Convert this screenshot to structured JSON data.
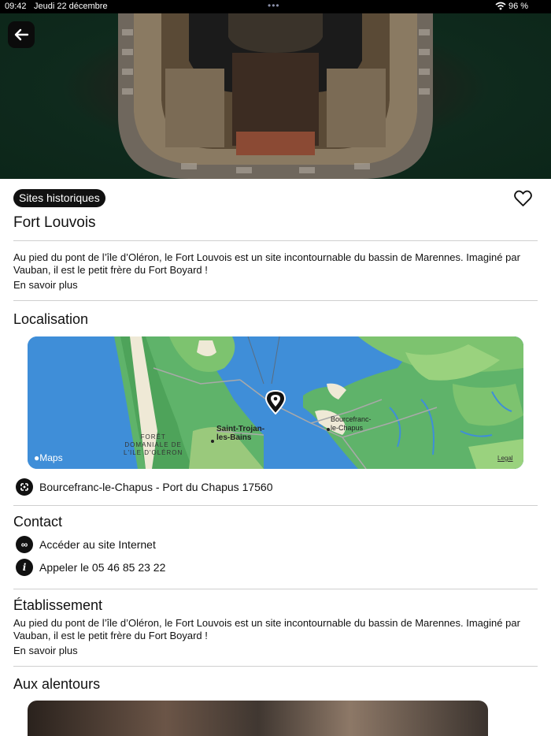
{
  "status_bar": {
    "time": "09:42",
    "date": "Jeudi 22 décembre",
    "battery": "96 %"
  },
  "place": {
    "category": "Sites historiques",
    "name": "Fort Louvois",
    "description": "Au pied du pont de l’île d’Oléron, le Fort Louvois est un site incontournable du bassin de Marennes. Imaginé par Vauban, il est le petit frère du Fort Boyard !",
    "more_label": "En savoir plus"
  },
  "location": {
    "heading": "Localisation",
    "address": "Bourcefranc-le-Chapus - Port du Chapus 17560",
    "map": {
      "label_saint_trojan": "Saint-Trojan-\nles-Bains",
      "label_bourcefranc": "Bourcefranc-\nle-Chapus",
      "label_foret": "FORÊT\nDOMANIALE DE\nL'ILE D'OLÉRON",
      "maps_logo": "Maps",
      "legal": "Legal"
    }
  },
  "contact": {
    "heading": "Contact",
    "website_label": "Accéder au site Internet",
    "phone_label": "Appeler le 05 46 85 23 22"
  },
  "establishment": {
    "heading": "Établissement",
    "description": "Au pied du pont de l’île d’Oléron, le Fort Louvois est un site incontournable du bassin de Marennes. Imaginé par Vauban, il est le petit frère du Fort Boyard !",
    "more_label": "En savoir plus"
  },
  "nearby": {
    "heading": "Aux alentours"
  },
  "icons": {
    "back": "arrow-left-icon",
    "favorite": "heart-icon",
    "address": "location-arrows-icon",
    "website": "infinity-link-icon",
    "phone": "info-icon",
    "wifi": "wifi-icon",
    "battery": "battery-icon"
  }
}
